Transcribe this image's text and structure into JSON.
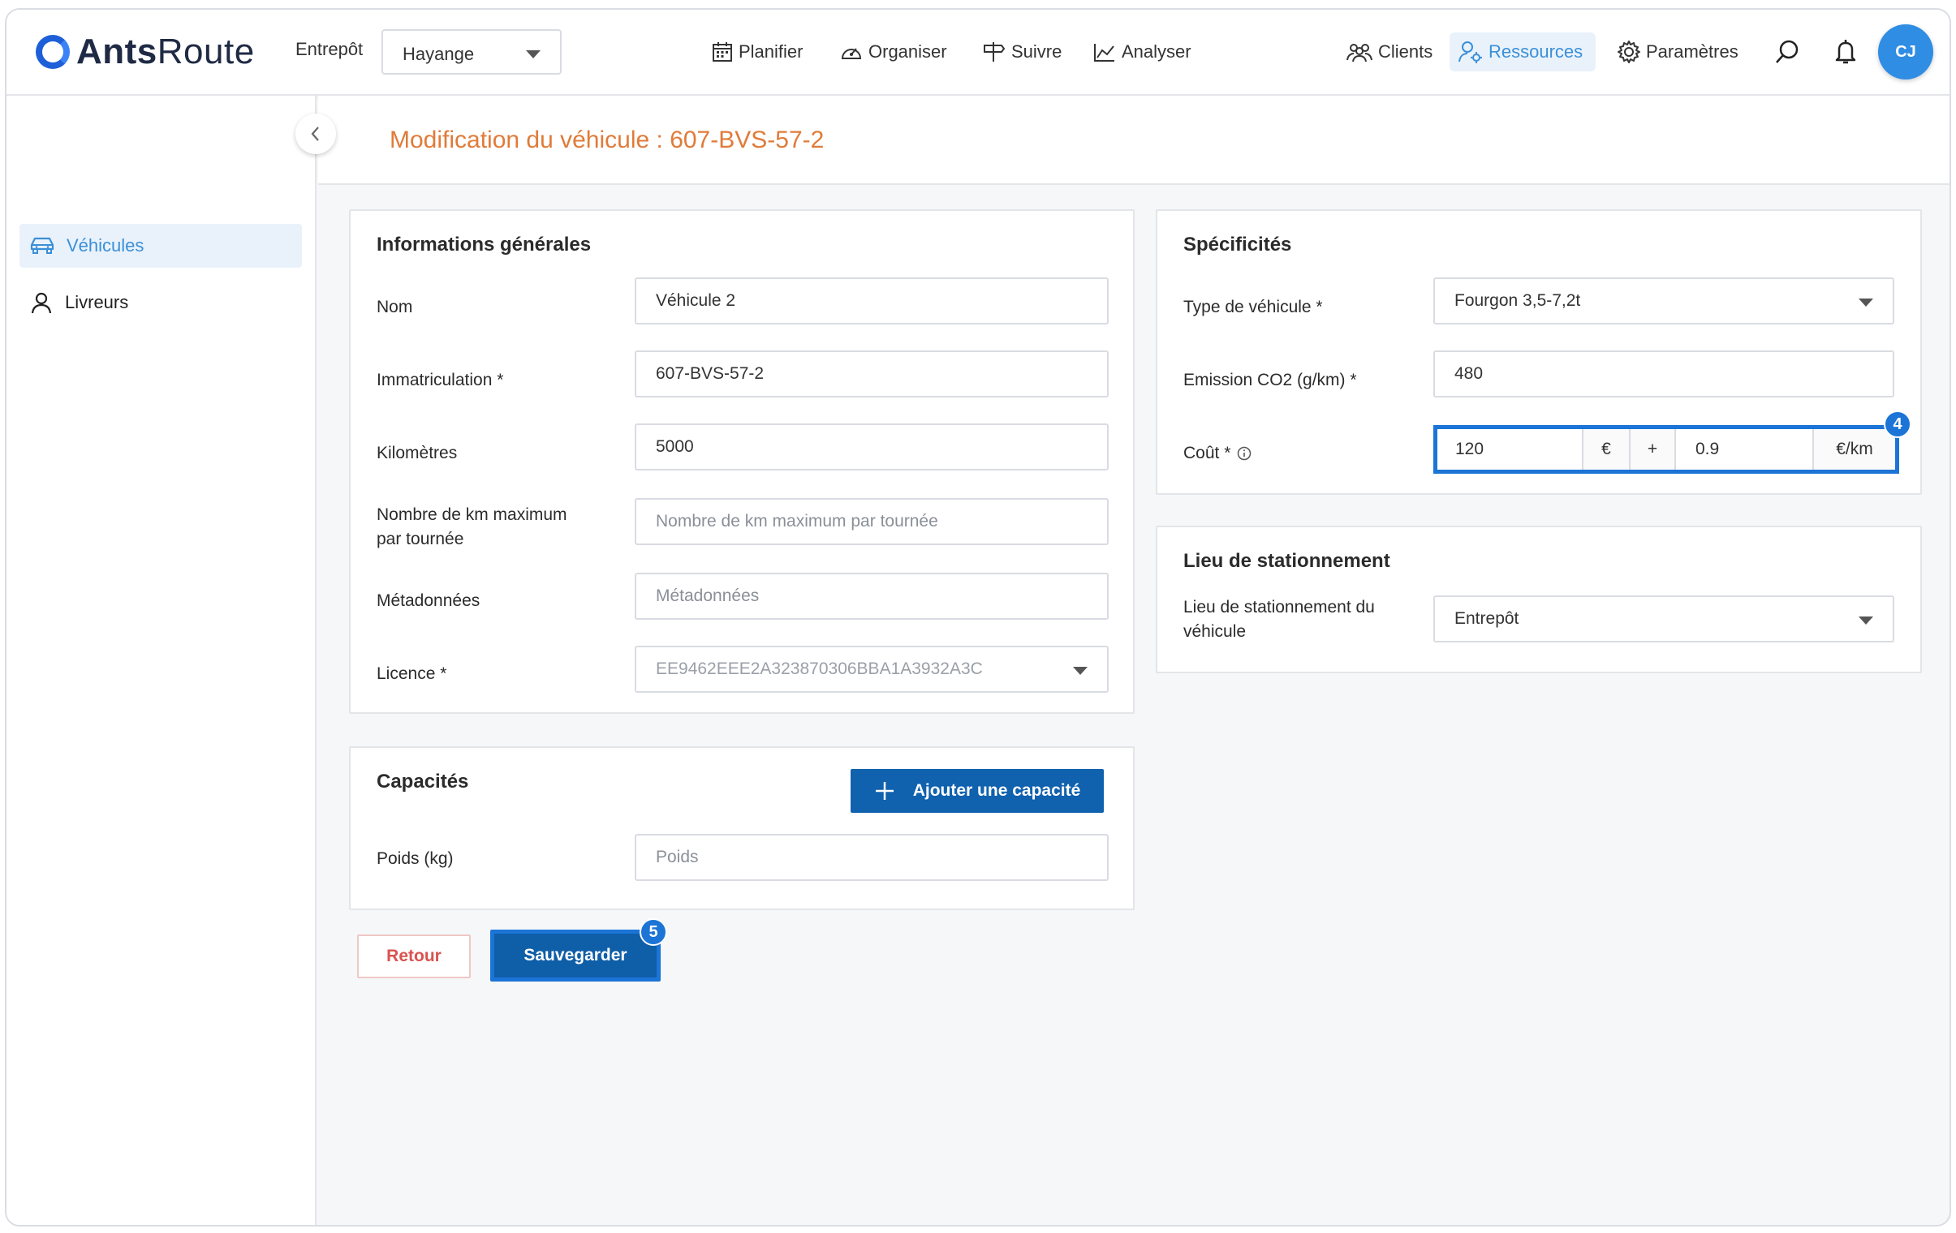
{
  "app": {
    "logo_bold": "Ants",
    "logo_rest": "Route"
  },
  "header": {
    "warehouse_label": "Entrepôt",
    "warehouse_value": "Hayange",
    "nav": {
      "planifier": "Planifier",
      "organiser": "Organiser",
      "suivre": "Suivre",
      "analyser": "Analyser",
      "clients": "Clients",
      "ressources": "Ressources",
      "parametres": "Paramètres"
    },
    "avatar_initials": "CJ"
  },
  "sidebar": {
    "vehicules": "Véhicules",
    "livreurs": "Livreurs"
  },
  "page": {
    "title": "Modification du véhicule : 607-BVS-57-2"
  },
  "general": {
    "title": "Informations générales",
    "nom_label": "Nom",
    "nom_value": "Véhicule 2",
    "immat_label": "Immatriculation *",
    "immat_value": "607-BVS-57-2",
    "km_label": "Kilomètres",
    "km_value": "5000",
    "kmmax_label_1": "Nombre de km maximum",
    "kmmax_label_2": "par tournée",
    "kmmax_placeholder": "Nombre de km maximum par tournée",
    "meta_label": "Métadonnées",
    "meta_placeholder": "Métadonnées",
    "licence_label": "Licence *",
    "licence_value": "EE9462EEE2A323870306BBA1A3932A3C"
  },
  "capacites": {
    "title": "Capacités",
    "add_button": "Ajouter une capacité",
    "poids_label": "Poids (kg)",
    "poids_placeholder": "Poids"
  },
  "specificites": {
    "title": "Spécificités",
    "type_label": "Type de véhicule *",
    "type_value": "Fourgon 3,5-7,2t",
    "co2_label": "Emission CO2 (g/km) *",
    "co2_value": "480",
    "cout_label": "Coût *",
    "cout_fixed": "120",
    "cout_currency": "€",
    "cout_plus": "+",
    "cout_per_km": "0.9",
    "cout_unit": "€/km"
  },
  "stationnement": {
    "title": "Lieu de stationnement",
    "label_1": "Lieu de stationnement du",
    "label_2": "véhicule",
    "value": "Entrepôt"
  },
  "actions": {
    "retour": "Retour",
    "sauvegarder": "Sauvegarder"
  },
  "badges": {
    "cost_step": "4",
    "save_step": "5"
  }
}
